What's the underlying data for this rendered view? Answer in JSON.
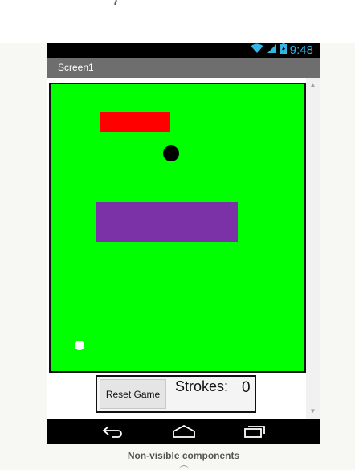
{
  "status_bar": {
    "time": "9:48",
    "icons": [
      "wifi-icon",
      "signal-icon",
      "battery-icon"
    ]
  },
  "screen": {
    "title": "Screen1"
  },
  "canvas": {
    "background_color": "#00ff00",
    "sprites": [
      {
        "name": "red-rectangle",
        "color": "#ff0000"
      },
      {
        "name": "purple-rectangle",
        "color": "#7b32a6"
      },
      {
        "name": "black-ball",
        "color": "#000000"
      },
      {
        "name": "white-ball",
        "color": "#ffffff"
      }
    ]
  },
  "controls": {
    "reset_label": "Reset Game",
    "strokes_label": "Strokes:",
    "strokes_value": "0"
  },
  "nav_bar": {
    "icons": [
      "back-icon",
      "home-icon",
      "recents-icon"
    ]
  },
  "footer": {
    "nonvisible_label": "Non-visible components"
  }
}
